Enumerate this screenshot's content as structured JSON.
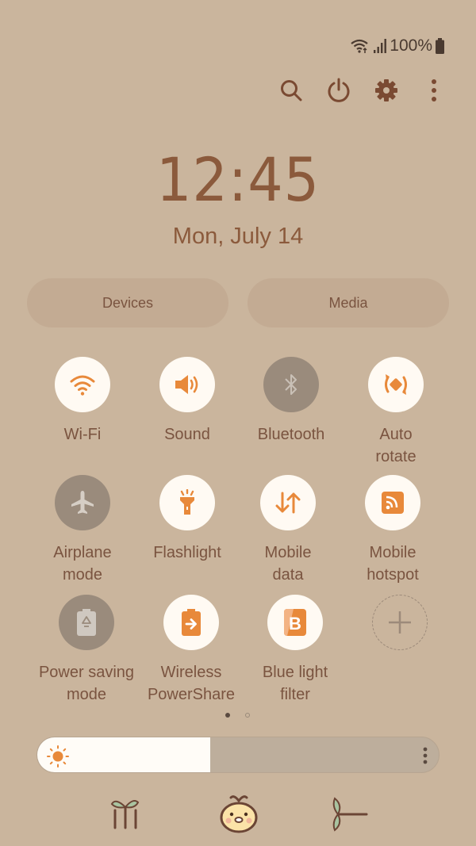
{
  "status_bar": {
    "wifi_icon": "wifi-calling-icon",
    "signal_icon": "signal-bars-icon",
    "battery_percent": "100%",
    "battery_icon": "battery-full-icon"
  },
  "top_actions": [
    {
      "name": "search",
      "icon": "search-icon"
    },
    {
      "name": "power",
      "icon": "power-icon"
    },
    {
      "name": "settings",
      "icon": "gear-icon"
    },
    {
      "name": "more",
      "icon": "more-vert-icon"
    }
  ],
  "clock": {
    "time": "12:45",
    "date": "Mon, July 14"
  },
  "pills": {
    "devices": "Devices",
    "media": "Media"
  },
  "tiles": [
    {
      "label": "Wi-Fi",
      "icon": "wifi-icon",
      "state": "on"
    },
    {
      "label": "Sound",
      "icon": "volume-icon",
      "state": "on"
    },
    {
      "label": "Bluetooth",
      "icon": "bluetooth-icon",
      "state": "off"
    },
    {
      "label": "Auto\nrotate",
      "icon": "auto-rotate-icon",
      "state": "on"
    },
    {
      "label": "Airplane\nmode",
      "icon": "airplane-icon",
      "state": "off"
    },
    {
      "label": "Flashlight",
      "icon": "flashlight-icon",
      "state": "on"
    },
    {
      "label": "Mobile\ndata",
      "icon": "mobile-data-icon",
      "state": "on"
    },
    {
      "label": "Mobile\nhotspot",
      "icon": "hotspot-icon",
      "state": "on"
    },
    {
      "label": "Power saving\nmode",
      "icon": "power-saving-icon",
      "state": "off"
    },
    {
      "label": "Wireless\nPowerShare",
      "icon": "wireless-powershare-icon",
      "state": "on"
    },
    {
      "label": "Blue light\nfilter",
      "icon": "blue-light-filter-icon",
      "state": "on"
    },
    {
      "label": "",
      "icon": "add-icon",
      "state": "add"
    }
  ],
  "pager": {
    "current_page": 1,
    "total_pages": 2
  },
  "brightness": {
    "level_percent": 43
  },
  "colors": {
    "background": "#cab59d",
    "accent": "#e8893a",
    "text": "#7a5440",
    "tile_on": "#fffaf3",
    "tile_off": "#9a8b7c"
  },
  "decorations": [
    "sprout-icon",
    "chick-icon",
    "leaf-icon"
  ]
}
